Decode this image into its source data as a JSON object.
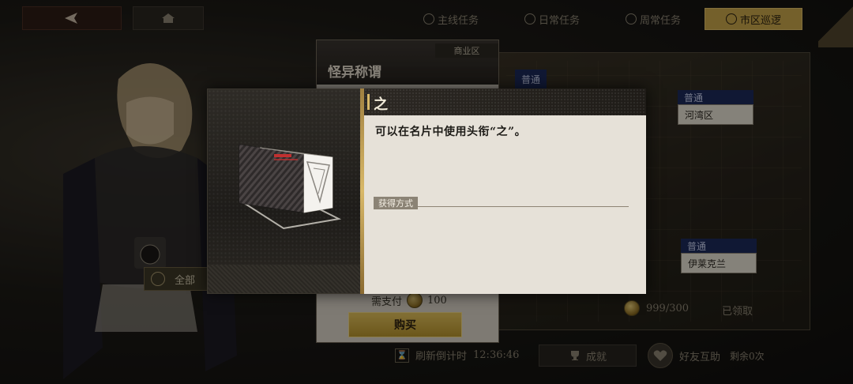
{
  "top_bar": {
    "tabs": [
      {
        "label": "主线任务",
        "icon": "triangle-icon"
      },
      {
        "label": "日常任务",
        "icon": "calendar-icon"
      },
      {
        "label": "周常任务",
        "icon": "compass-icon"
      },
      {
        "label": "市区巡逻",
        "icon": "globe-icon",
        "active": true
      }
    ]
  },
  "left": {
    "all_button_label": "全部"
  },
  "shop_card": {
    "zone": "商业区",
    "title": "怪异称谓",
    "price_label": "需支付",
    "price_value": "100",
    "buy_label": "购买"
  },
  "map": {
    "tags": [
      {
        "badge": "普通",
        "location": ""
      },
      {
        "badge": "普通",
        "location": "河湾区"
      },
      {
        "badge": "普通",
        "location": "伊莱克兰"
      }
    ],
    "progress": "999/300",
    "claimed": "已领取"
  },
  "bottom_bar": {
    "refresh_label": "刷新倒计时",
    "refresh_time": "12:36:46",
    "achievements_label": "成就",
    "friend_help_label": "好友互助",
    "friend_remaining": "剩余0次"
  },
  "modal": {
    "item_title": "之",
    "description": "可以在名片中使用头衔“之”。",
    "obtain_label": "获得方式",
    "obtain_methods": []
  },
  "colors": {
    "accent_gold": "#c9a64a",
    "badge_blue": "#1d2a5a",
    "paper": "#e6e1d8"
  }
}
